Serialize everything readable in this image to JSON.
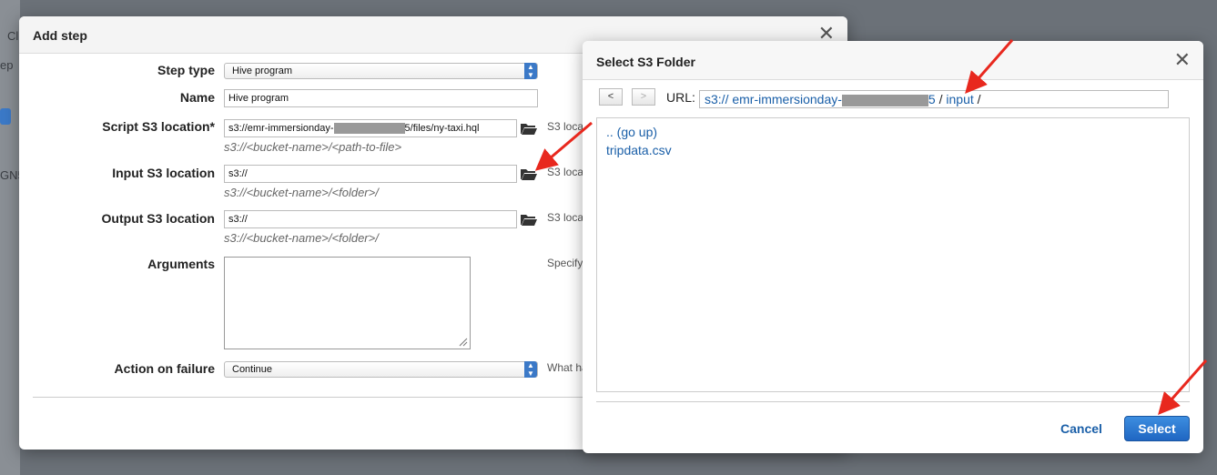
{
  "background": {
    "frag1": "Cl",
    "frag2": "ep",
    "frag3": "GN5"
  },
  "add_step": {
    "title": "Add step",
    "fields": {
      "step_type": {
        "label": "Step type",
        "value": "Hive program"
      },
      "name": {
        "label": "Name",
        "value": "Hive program"
      },
      "script": {
        "label": "Script S3 location*",
        "value_prefix": "s3://emr-immersionday-",
        "value_suffix": "5/files/ny-taxi.hql",
        "hint": "s3://<bucket-name>/<path-to-file>",
        "side": "S3 loca"
      },
      "input": {
        "label": "Input S3 location",
        "value": "s3://",
        "hint": "s3://<bucket-name>/<folder>/",
        "side": "S3 loca"
      },
      "output": {
        "label": "Output S3 location",
        "value": "s3://",
        "hint": "s3://<bucket-name>/<folder>/",
        "side": "S3 loca"
      },
      "arguments": {
        "label": "Arguments",
        "side": "Specify"
      },
      "action_on_failure": {
        "label": "Action on failure",
        "value": "Continue",
        "side": "What ha"
      }
    }
  },
  "s3_folder": {
    "title": "Select S3 Folder",
    "nav": {
      "back": "<",
      "forward": ">"
    },
    "url_label": "URL:",
    "url": {
      "prefix": "s3:// emr-immersionday-",
      "suffix": "5",
      "sep1": "/",
      "folder": "input",
      "sep2": "/"
    },
    "items": [
      ".. (go up)",
      "tripdata.csv"
    ],
    "cancel_label": "Cancel",
    "select_label": "Select"
  },
  "colors": {
    "link": "#1a5fa8",
    "primary": "#1f66c2",
    "annotation_arrow": "#e8281e"
  }
}
